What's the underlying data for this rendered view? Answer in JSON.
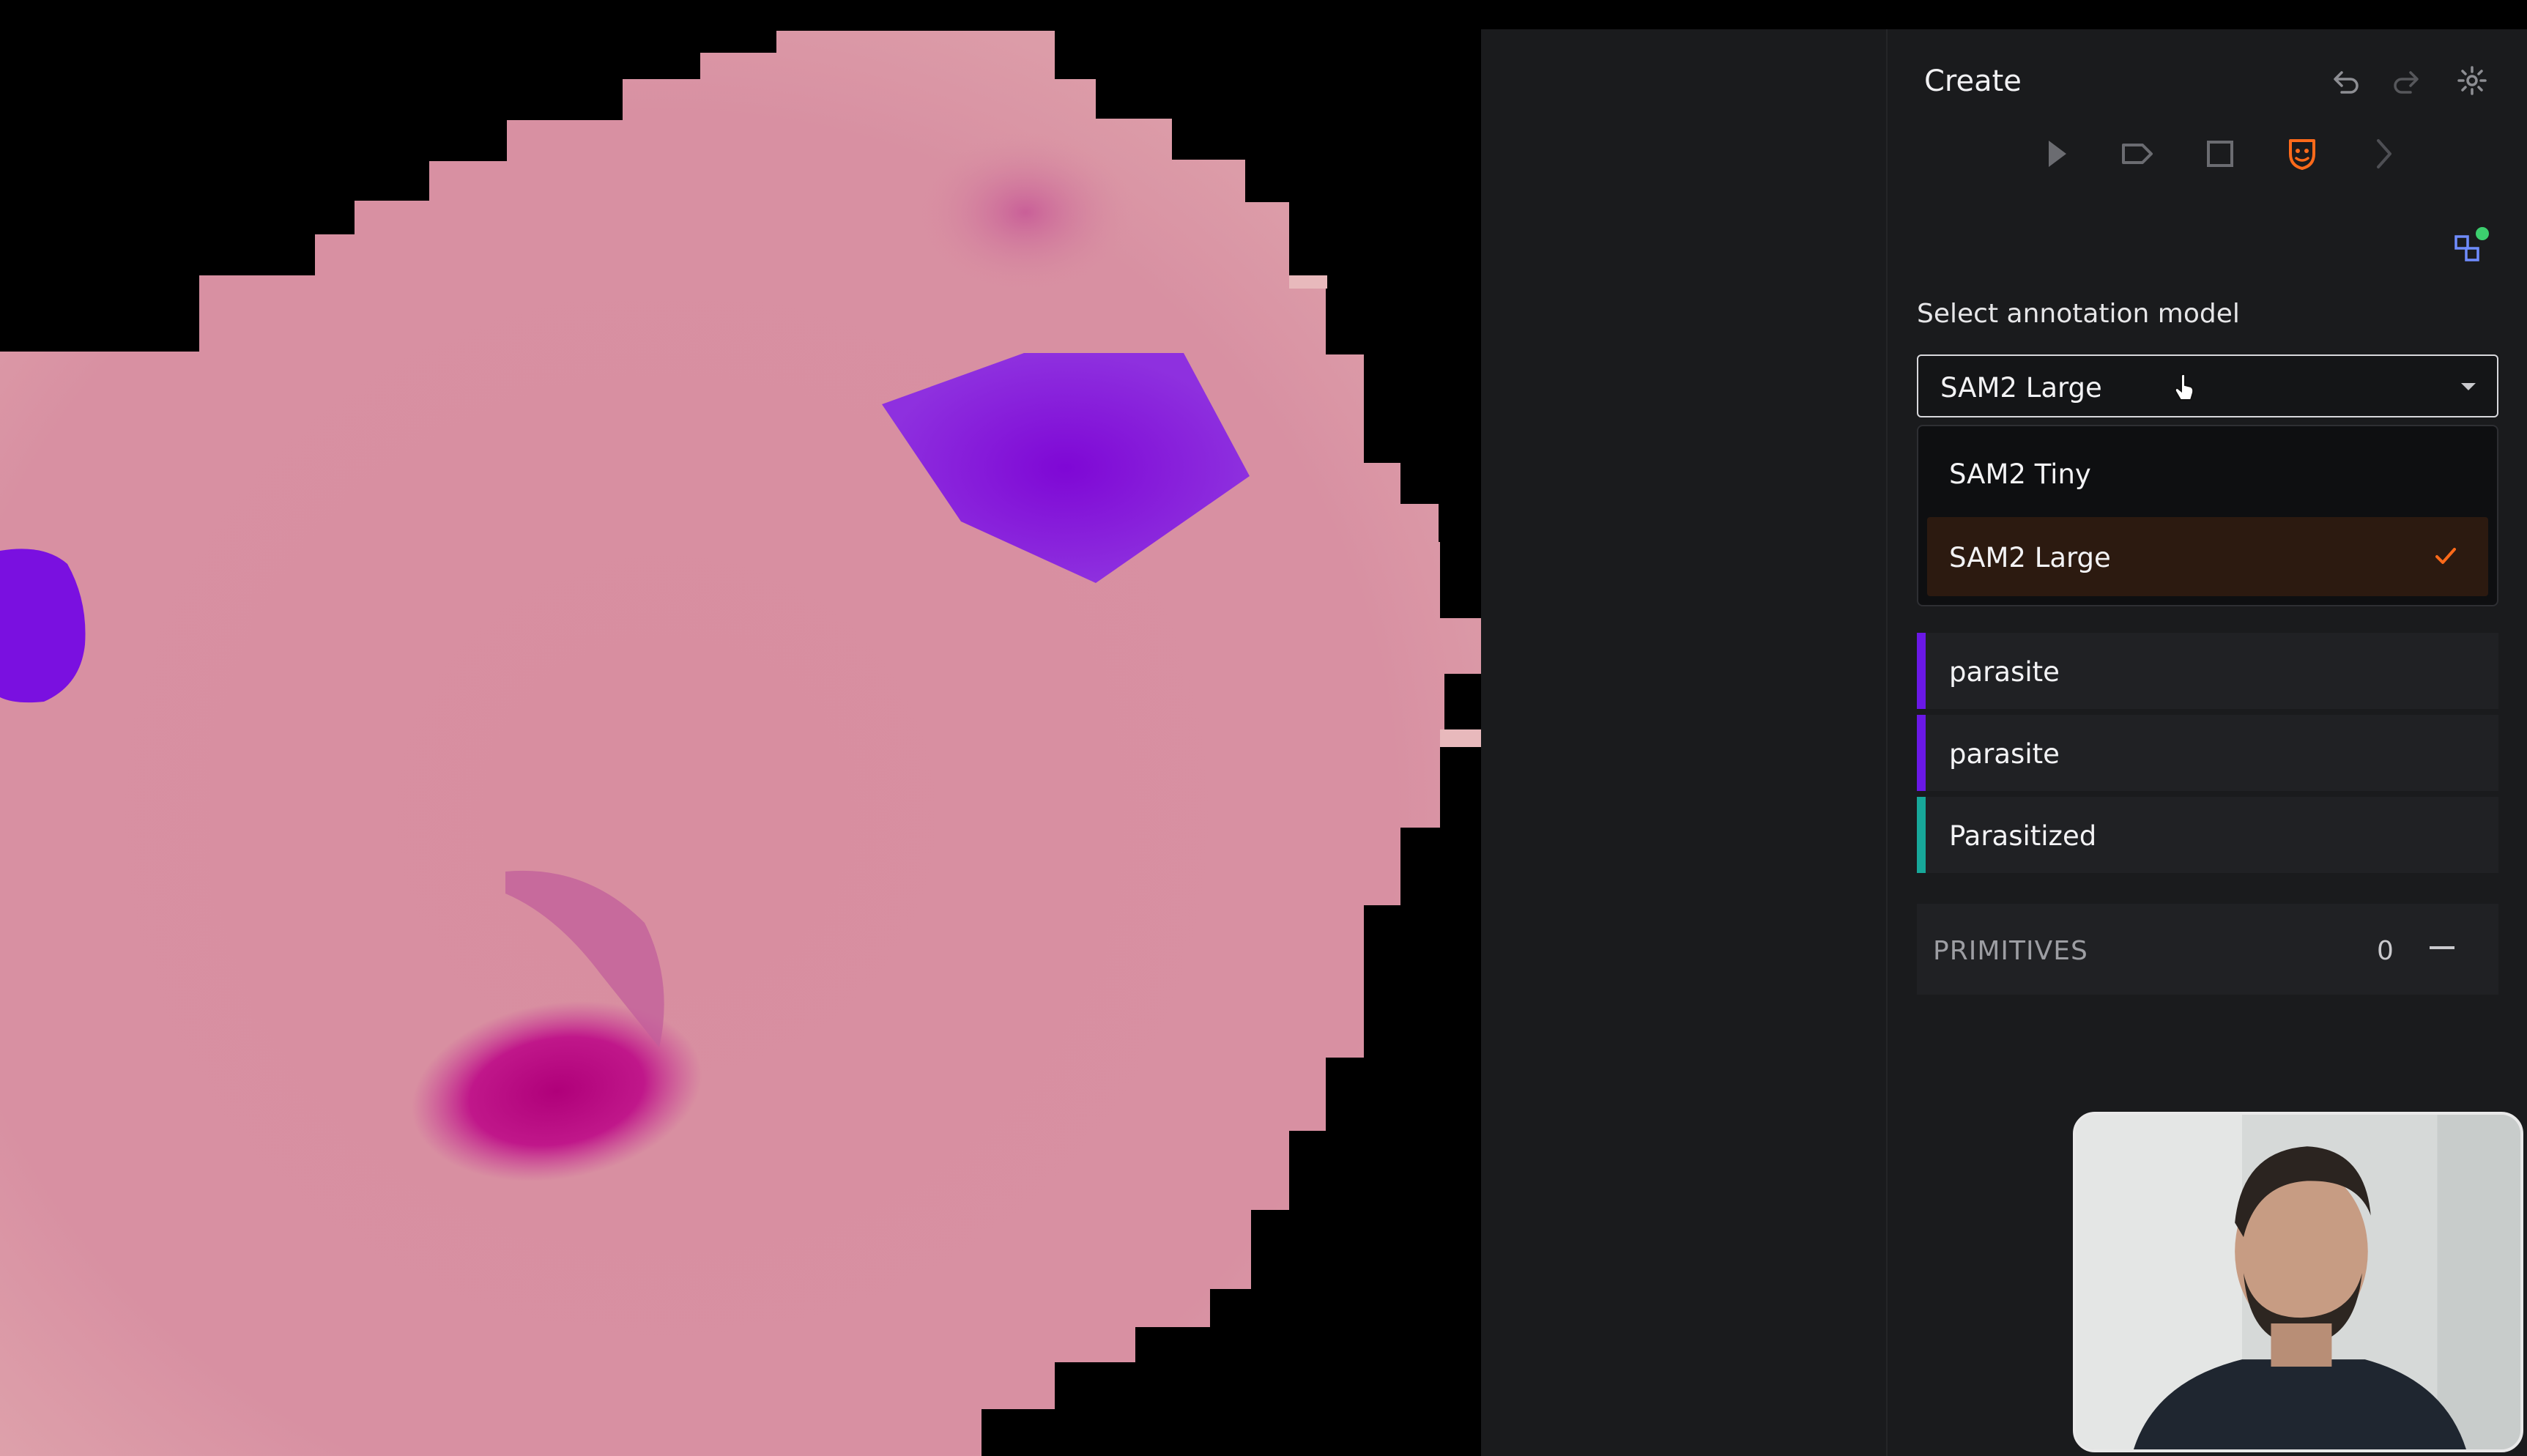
{
  "panel": {
    "title": "Create",
    "header_icons": [
      "undo-icon",
      "redo-icon",
      "gear-icon"
    ],
    "tools": [
      {
        "name": "select-tool",
        "icon": "pointer-arrow-icon",
        "active": false
      },
      {
        "name": "label-tool",
        "icon": "tag-icon",
        "active": false
      },
      {
        "name": "box-tool",
        "icon": "square-icon",
        "active": false
      },
      {
        "name": "smart-mask-tool",
        "icon": "mask-icon",
        "active": true
      },
      {
        "name": "polyline-tool",
        "icon": "polyline-icon",
        "active": false
      }
    ],
    "extension_icon": "ai-model-status-icon",
    "model_label": "Select annotation model",
    "model_select": {
      "value": "SAM2 Large"
    },
    "model_options": [
      {
        "label": "SAM2 Tiny",
        "selected": false
      },
      {
        "label": "SAM2 Large",
        "selected": true
      }
    ],
    "classes": [
      {
        "label": "parasite",
        "color": "#6a18e6"
      },
      {
        "label": "parasite",
        "color": "#6a18e6"
      },
      {
        "label": "Parasitized",
        "color": "#17a89a"
      }
    ],
    "primitives": {
      "label": "PRIMITIVES",
      "count": "0"
    }
  },
  "colors": {
    "accent": "#ff6a1a",
    "panel_bg": "#1a1b1d",
    "cell_pink": "#d68ea0",
    "mask_purple": "#8a2be2"
  }
}
